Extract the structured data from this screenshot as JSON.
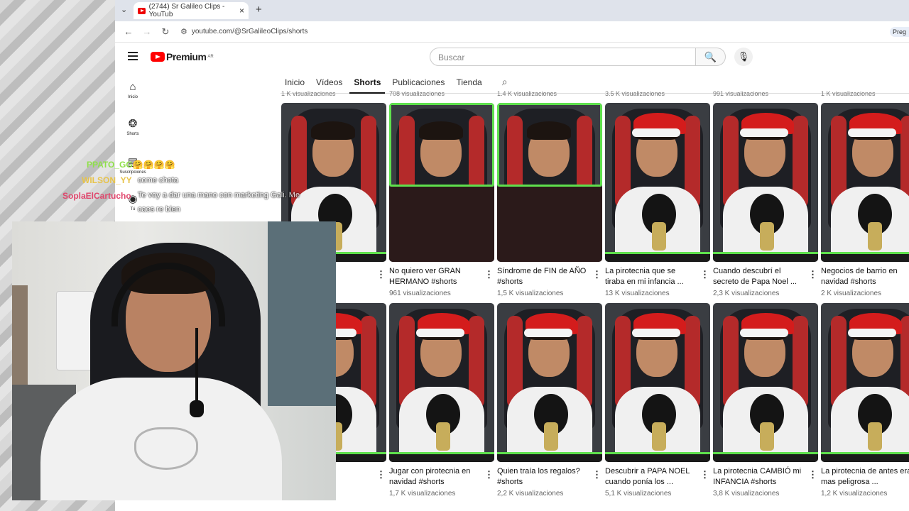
{
  "browser": {
    "tab_title": "(2744) Sr Galileo Clips - YouTub",
    "tab_close": "×",
    "tab_dropdown": "⌄",
    "new_tab": "+",
    "url": "youtube.com/@SrGalileoClips/shorts",
    "right_chip": "Preg",
    "back_icon": "←",
    "forward_icon": "→",
    "reload_icon": "↻",
    "site_info_icon": "⚙"
  },
  "youtube": {
    "brand": "Premium",
    "region": "AR",
    "search_placeholder": "Buscar",
    "search_icon": "🔍",
    "mic_icon": "🎙",
    "leftnav": [
      {
        "icon": "⌂",
        "label": "Inicio"
      },
      {
        "icon": "❂",
        "label": "Shorts"
      },
      {
        "icon": "▤",
        "label": "Suscripciones"
      },
      {
        "icon": "◉",
        "label": "Tú"
      }
    ],
    "tabs": [
      "Inicio",
      "Vídeos",
      "Shorts",
      "Publicaciones",
      "Tienda"
    ],
    "active_tab": "Shorts",
    "tabs_search_icon": "⌕",
    "top_views": [
      "1 K visualizaciones",
      "708 visualizaciones",
      "1,4 K visualizaciones",
      "3,5 K visualizaciones",
      "991 visualizaciones",
      "1 K visualizaciones"
    ],
    "row1": [
      {
        "title": "no de la",
        "views": "s"
      },
      {
        "title": "No quiero ver GRAN HERMANO #shorts",
        "views": "961 visualizaciones"
      },
      {
        "title": "Síndrome de FIN de AÑO #shorts",
        "views": "1,5 K visualizaciones"
      },
      {
        "title": "La pirotecnia que se tiraba en mi infancia ...",
        "views": "13 K visualizaciones"
      },
      {
        "title": "Cuando descubrí el secreto de Papa Noel ...",
        "views": "2,3 K visualizaciones"
      },
      {
        "title": "Negocios de barrio en navidad #shorts",
        "views": "2 K visualizaciones"
      }
    ],
    "row2": [
      {
        "title": "aban AD ...",
        "views": "es"
      },
      {
        "title": "Jugar con pirotecnia en navidad #shorts",
        "views": "1,7 K visualizaciones"
      },
      {
        "title": "Quien traía los regalos? #shorts",
        "views": "2,2 K visualizaciones"
      },
      {
        "title": "Descubrir a PAPA NOEL cuando ponía los ...",
        "views": "5,1 K visualizaciones"
      },
      {
        "title": "La pirotecnia CAMBIÓ mi INFANCIA #shorts",
        "views": "3,8 K visualizaciones"
      },
      {
        "title": "La pirotecnia de antes era mas peligrosa ...",
        "views": "1,2 K visualizaciones"
      }
    ],
    "more_icon": "⋮"
  },
  "chat": [
    {
      "user": "PPATO_GG",
      "emotes": "🤗🤗🤗🤗",
      "message": "",
      "color": "#8fe04a"
    },
    {
      "user": "WILSON_YY",
      "message": "come chota",
      "color": "#e7c34a"
    },
    {
      "user": "SoplaElCartucho",
      "message": "Te voy a dar una mano con marketing Gali. Me",
      "message2": "caes re bien",
      "color": "#e0466c"
    }
  ],
  "colors": {
    "youtube_red": "#ff0000",
    "green_frame": "#5fe04d"
  }
}
